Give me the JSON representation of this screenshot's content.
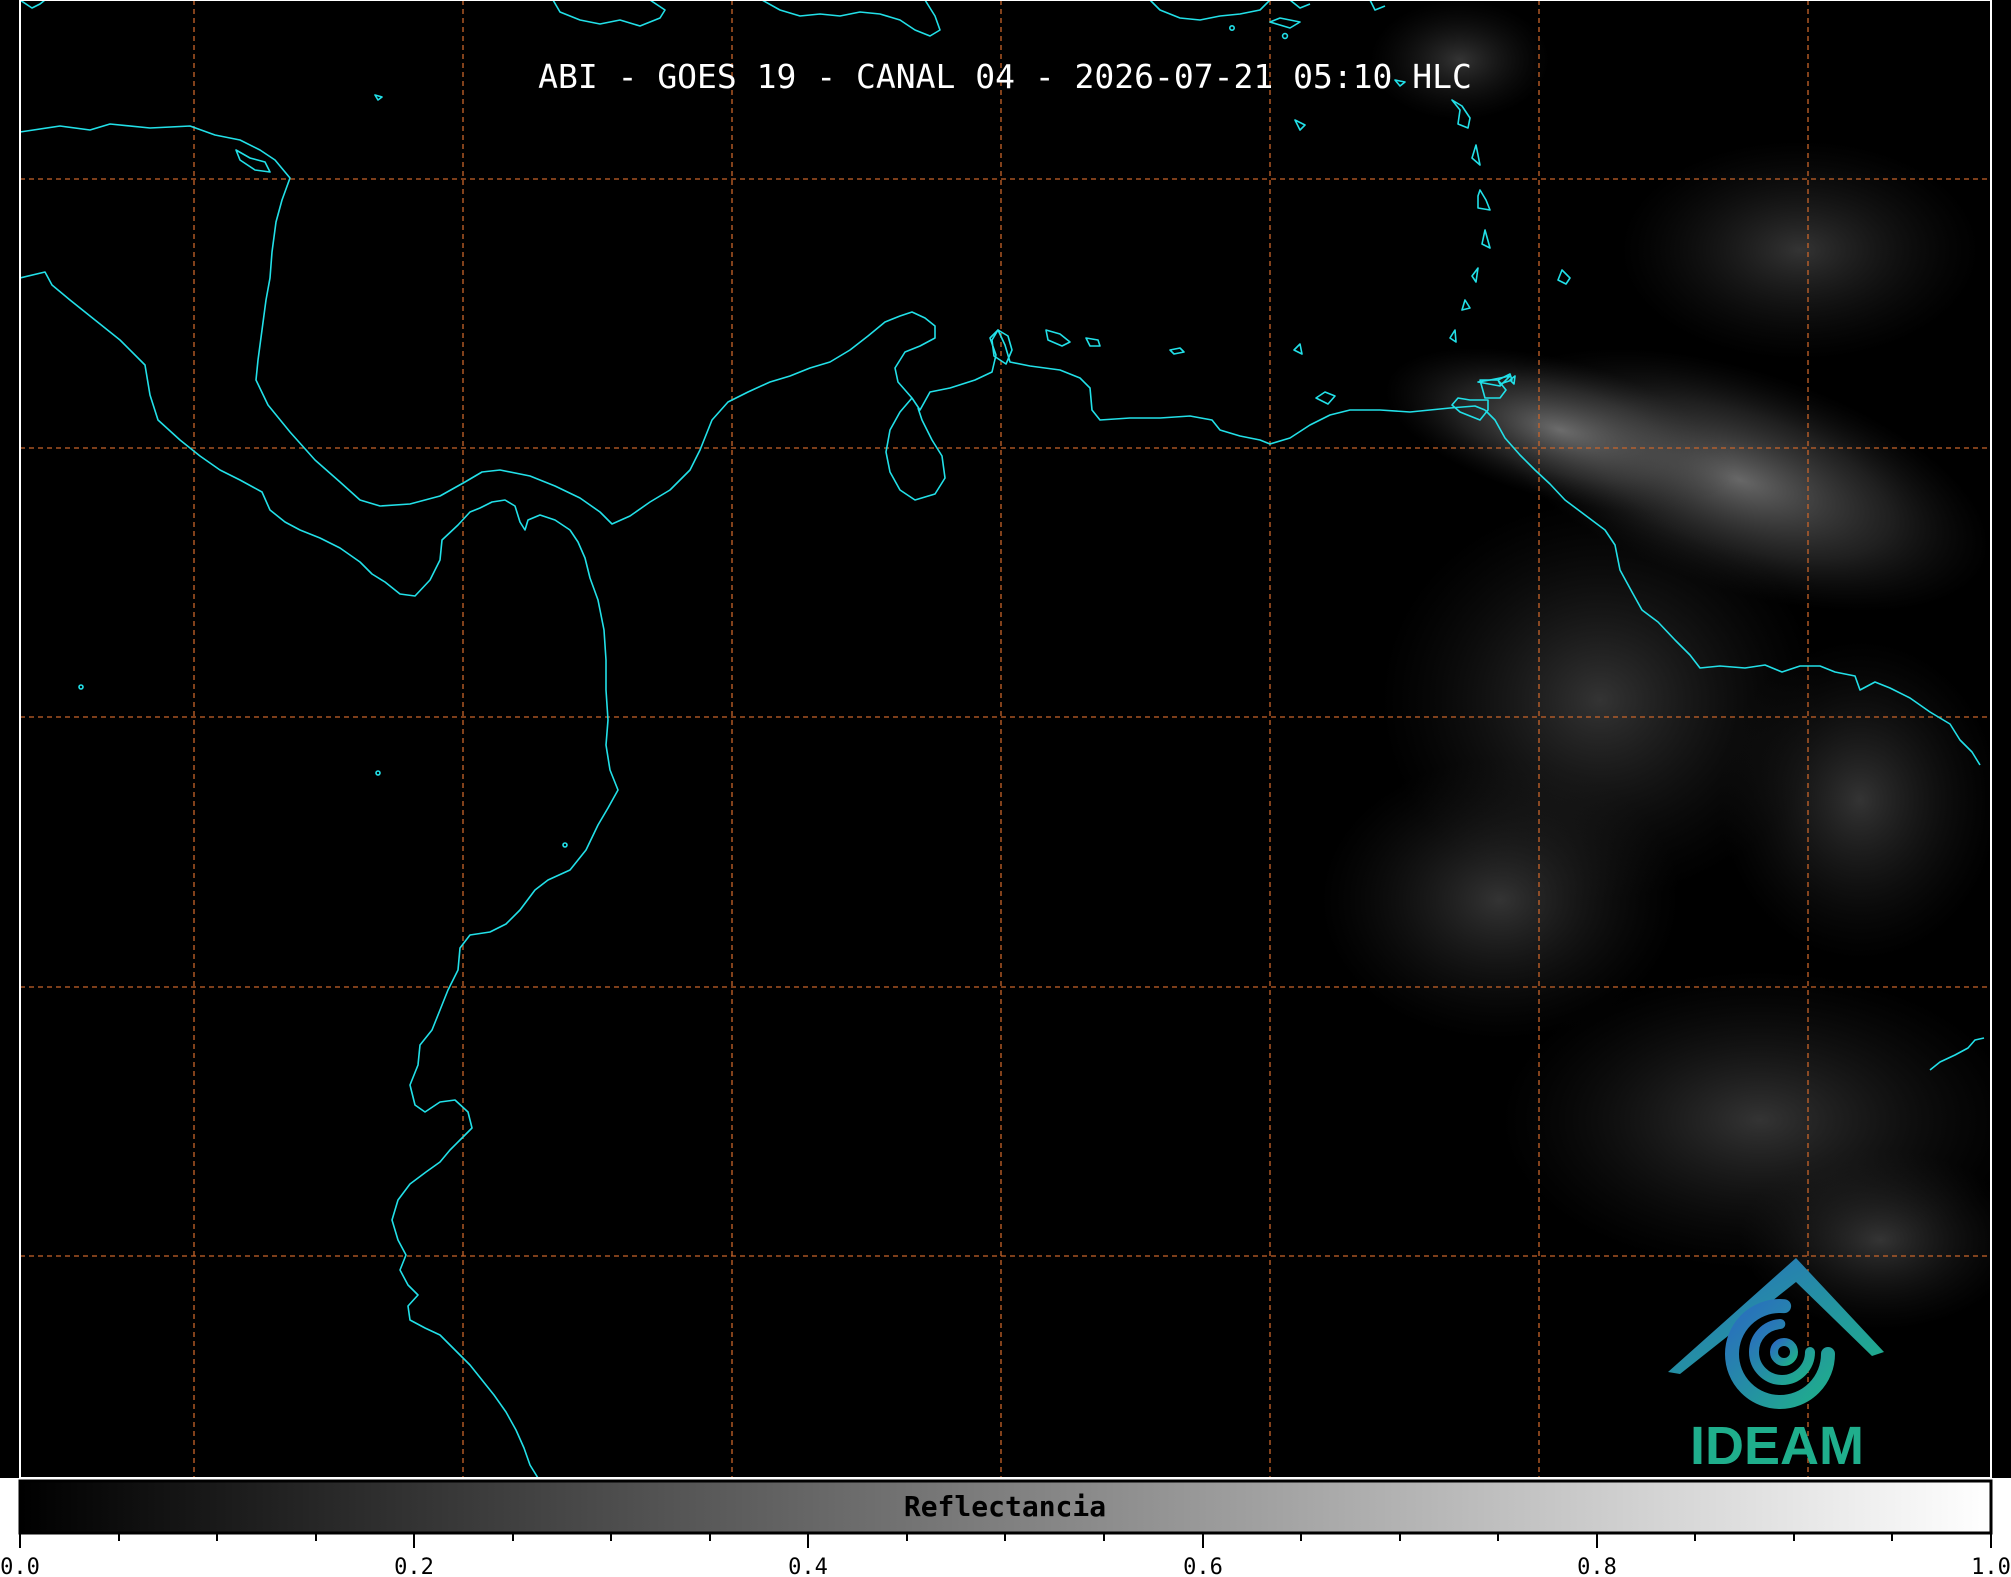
{
  "title": "ABI - GOES 19 - CANAL 04 - 2026-07-21 05:10 HLC",
  "colorbar": {
    "label": "Reflectancia",
    "ticks": [
      "0.0",
      "0.2",
      "0.4",
      "0.6",
      "0.8",
      "1.0"
    ],
    "range": [
      0.0,
      1.0
    ],
    "gradient": [
      "#000000",
      "#ffffff"
    ]
  },
  "logo": {
    "text": "IDEAM"
  },
  "colors": {
    "background": "#000000",
    "coastline": "#22e0e8",
    "gridlines": "#c8642a",
    "logo_blue": "#2a7ab8",
    "logo_teal": "#1fae8c"
  }
}
